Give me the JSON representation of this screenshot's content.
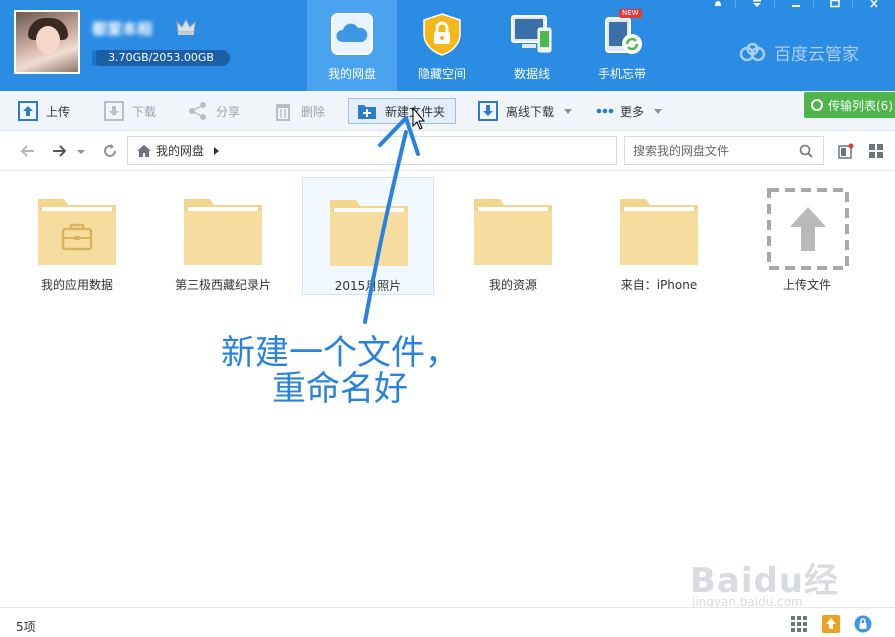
{
  "header": {
    "username": "都爱本相",
    "quota_text": "3.70GB/2053.00GB",
    "quota_fraction": 0.0018,
    "tabs": [
      {
        "label": "我的网盘",
        "icon": "cloud-icon",
        "active": true
      },
      {
        "label": "隐藏空间",
        "icon": "lock-icon",
        "active": false
      },
      {
        "label": "数据线",
        "icon": "devices-icon",
        "active": false
      },
      {
        "label": "手机忘带",
        "icon": "phone-sync-icon",
        "badge": "NEW",
        "active": false
      }
    ],
    "brand": "百度云管家",
    "colors": {
      "header_bg": "#2b8ce3",
      "active_tab": "#4aa3ee"
    }
  },
  "toolbar": {
    "upload": "上传",
    "download": "下载",
    "share": "分享",
    "delete": "删除",
    "new_folder": "新建文件夹",
    "offline_download": "离线下载",
    "more": "更多",
    "transfer_list": "传输列表(6)"
  },
  "address": {
    "breadcrumb": "我的网盘",
    "search_placeholder": "搜索我的网盘文件"
  },
  "files": [
    {
      "name": "我的应用数据",
      "icon": "app-folder-icon"
    },
    {
      "name": "第三极西藏纪录片",
      "icon": "folder-icon"
    },
    {
      "name": "2015月照片",
      "icon": "folder-icon",
      "selected": true
    },
    {
      "name": "我的资源",
      "icon": "folder-icon"
    },
    {
      "name": "来自：iPhone",
      "icon": "folder-icon"
    },
    {
      "name": "上传文件",
      "icon": "upload-placeholder-icon"
    }
  ],
  "annotation": {
    "line1": "新建一个文件，",
    "line2": "重命名好",
    "color": "#2a82e0"
  },
  "watermark": {
    "main": "Baidu经验",
    "sub": "jingyan.baidu.com"
  },
  "status": {
    "item_count": "5项"
  }
}
